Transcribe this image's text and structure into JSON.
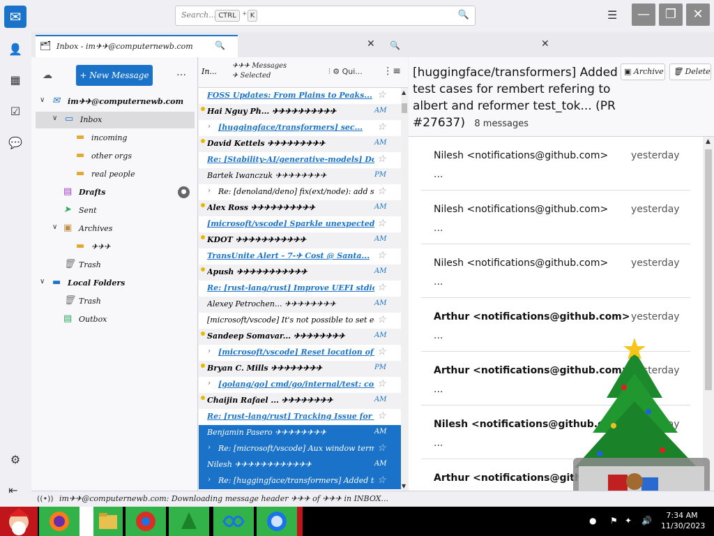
{
  "window": {
    "search_placeholder": "Search...",
    "search_kbd1": "CTRL",
    "search_kbd_sep": "+",
    "search_kbd2": "K",
    "minimize": "—",
    "restore": "❐",
    "close": "✕"
  },
  "tab": {
    "label": "Inbox - im✈✈@computernewb.com"
  },
  "folders": {
    "new_message": "+ New Message",
    "items": [
      {
        "label": "im✈✈@computernewb.com",
        "bold": true,
        "icon": "account-icon"
      },
      {
        "label": "Inbox",
        "icon": "inbox-icon"
      },
      {
        "label": "incoming",
        "icon": "folder-icon"
      },
      {
        "label": "other orgs",
        "icon": "folder-icon"
      },
      {
        "label": "real people",
        "icon": "folder-icon"
      },
      {
        "label": "Drafts",
        "icon": "drafts-icon"
      },
      {
        "label": "Sent",
        "icon": "sent-icon"
      },
      {
        "label": "Archives",
        "icon": "archives-icon"
      },
      {
        "label": "✈✈✈",
        "icon": "folder-icon"
      },
      {
        "label": "Trash",
        "icon": "trash-icon"
      },
      {
        "label": "Local Folders",
        "bold": true,
        "icon": "local-folders-icon"
      },
      {
        "label": "Trash",
        "icon": "trash-icon"
      },
      {
        "label": "Outbox",
        "icon": "outbox-icon"
      }
    ],
    "drafts_badge": "●"
  },
  "msglist": {
    "header_name": "In...",
    "header_count_line1": "✈✈✈ Messages",
    "header_count_line2": "✈ Selected",
    "header_tools": "⫶ ⚙ Qui...",
    "rows": [
      {
        "text": "FOSS Updates: From Plains to Peaks...",
        "style": "blue",
        "date": ""
      },
      {
        "text": "Hai Nguy Ph... ✈✈✈✈✈✈✈✈✈✈",
        "style": "bold",
        "date": "AM",
        "dot": true
      },
      {
        "text": "[huggingface/transformers] sec...",
        "style": "blue indent",
        "date": "",
        "twisty": true
      },
      {
        "text": "David Kettels ✈✈✈✈✈✈✈✈✈",
        "style": "bold",
        "date": "AM",
        "dot": true
      },
      {
        "text": "Re: [Stability-AI/generative-models] Do...",
        "style": "blue",
        "date": ""
      },
      {
        "text": "Bartek Iwanczuk ✈✈✈✈✈✈✈✈",
        "style": "",
        "date": "PM"
      },
      {
        "text": "Re: [denoland/deno] fix(ext/node): add stu...",
        "style": "indent",
        "date": "",
        "twisty": true
      },
      {
        "text": "Alex Ross ✈✈✈✈✈✈✈✈✈✈",
        "style": "bold",
        "date": "AM",
        "dot": true
      },
      {
        "text": "[microsoft/vscode] Sparkle unexpectedly dis...",
        "style": "blue",
        "date": ""
      },
      {
        "text": "KDOT ✈✈✈✈✈✈✈✈✈✈✈",
        "style": "bold",
        "date": "AM",
        "dot": true
      },
      {
        "text": "TransUnite Alert - 7-✈ Cost @ Santa...",
        "style": "blue",
        "date": ""
      },
      {
        "text": "Apush ✈✈✈✈✈✈✈✈✈✈✈",
        "style": "bold",
        "date": "AM",
        "dot": true
      },
      {
        "text": "Re: [rust-lang/rust] Improve UEFI stdio...",
        "style": "blue",
        "date": ""
      },
      {
        "text": "Alexey Petrochen... ✈✈✈✈✈✈✈✈",
        "style": "",
        "date": "AM"
      },
      {
        "text": "[microsoft/vscode] It's not possible to set editor...",
        "style": "",
        "date": ""
      },
      {
        "text": "Sandeep Somavar... ✈✈✈✈✈✈✈✈",
        "style": "bold",
        "date": "AM",
        "dot": true
      },
      {
        "text": "[microsoft/vscode] Reset location of view...",
        "style": "blue indent",
        "date": "",
        "twisty": true
      },
      {
        "text": "Bryan C. Mills ✈✈✈✈✈✈✈✈",
        "style": "bold",
        "date": "PM",
        "dot": true
      },
      {
        "text": "[golang/go] cmd/go/internal/test: compute...",
        "style": "blue indent",
        "date": "",
        "twisty": true
      },
      {
        "text": "Chaijin Rafael ... ✈✈✈✈✈✈✈✈",
        "style": "bold",
        "date": "AM",
        "dot": true
      },
      {
        "text": "Re: [rust-lang/rust] Tracking Issue for ge...",
        "style": "blue",
        "date": ""
      },
      {
        "text": "Benjamin Pasero ✈✈✈✈✈✈✈✈",
        "style": "sel",
        "date": "AM"
      },
      {
        "text": "Re: [microsoft/vscode] Aux window termina...",
        "style": "sel indent",
        "date": "",
        "twisty": true
      },
      {
        "text": "Nilesh ✈✈✈✈✈✈✈✈✈✈✈✈",
        "style": "sel",
        "date": "AM"
      },
      {
        "text": "Re: [huggingface/transformers] Added test...",
        "style": "sel indent",
        "date": "",
        "twisty": true
      }
    ]
  },
  "reader": {
    "title": "[huggingface/transformers] Added test cases for rembert refering to albert and reformer test_tok... (PR #27637)",
    "count": "8 messages",
    "archive": "Archive",
    "delete": "Delete",
    "messages": [
      {
        "sender": "Nilesh <notifications@github.com>",
        "when": "yesterday",
        "snippet": "...",
        "bold": false
      },
      {
        "sender": "Nilesh <notifications@github.com>",
        "when": "yesterday",
        "snippet": "...",
        "bold": false
      },
      {
        "sender": "Nilesh <notifications@github.com>",
        "when": "yesterday",
        "snippet": "...",
        "bold": false
      },
      {
        "sender": "Arthur <notifications@github.com>",
        "when": "yesterday",
        "snippet": "...",
        "bold": true
      },
      {
        "sender": "Arthur <notifications@github.com>",
        "when": "yesterday",
        "snippet": "...",
        "bold": true
      },
      {
        "sender": "Nilesh <notifications@github.com>",
        "when": "yesterday",
        "snippet": "...",
        "bold": true
      },
      {
        "sender": "Arthur <notifications@github.com>",
        "when": "",
        "snippet": "",
        "bold": true
      }
    ]
  },
  "status": {
    "text": "im✈✈@computernewb.com: Downloading message header ✈✈✈ of ✈✈✈ in INBOX..."
  },
  "taskbar": {
    "time": "7:34 AM",
    "date": "11/30/2023"
  }
}
